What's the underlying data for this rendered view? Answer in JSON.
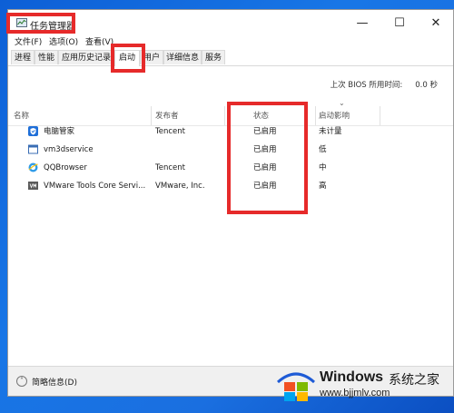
{
  "window": {
    "title": "任务管理器"
  },
  "controls": {
    "minimize": "—",
    "maximize": "☐",
    "close": "✕"
  },
  "menu": [
    {
      "label": "文件(F)"
    },
    {
      "label": "选项(O)"
    },
    {
      "label": "查看(V)"
    }
  ],
  "tabs": [
    {
      "label": "进程"
    },
    {
      "label": "性能"
    },
    {
      "label": "应用历史记录"
    },
    {
      "label": "启动",
      "active": true
    },
    {
      "label": "用户"
    },
    {
      "label": "详细信息"
    },
    {
      "label": "服务"
    }
  ],
  "bios": {
    "label": "上次 BIOS 所用时间:",
    "value": "0.0 秒"
  },
  "columns": {
    "name": "名称",
    "publisher": "发布者",
    "status": "状态",
    "impact": "启动影响"
  },
  "rows": [
    {
      "name": "电脑管家",
      "publisher": "Tencent",
      "status": "已启用",
      "impact": "未计量",
      "icon": "shield-icon"
    },
    {
      "name": "vm3dservice",
      "publisher": "",
      "status": "已启用",
      "impact": "低",
      "icon": "window-icon"
    },
    {
      "name": "QQBrowser",
      "publisher": "Tencent",
      "status": "已启用",
      "impact": "中",
      "icon": "qqbrowser-icon"
    },
    {
      "name": "VMware Tools Core Servi...",
      "publisher": "VMware, Inc.",
      "status": "已启用",
      "impact": "高",
      "icon": "vmware-icon"
    }
  ],
  "footer": {
    "label": "简略信息(D)"
  },
  "watermark": {
    "brand": "Windows",
    "brand_cn": "系统之家",
    "url": "www.bjjmlv.com"
  },
  "colors": {
    "highlight": "#e62a2a",
    "desktop": "#1876e6"
  }
}
